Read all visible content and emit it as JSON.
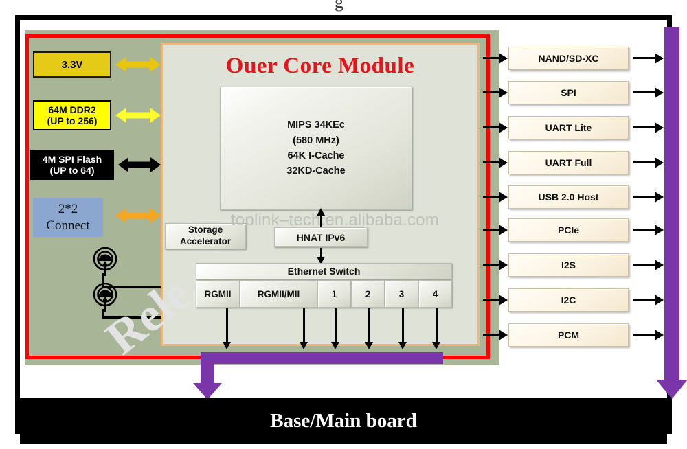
{
  "diagram": {
    "core_module": {
      "title": "Ouer Core Module",
      "cpu": {
        "line1": "MIPS 34KEc",
        "line2": "(580 MHz)",
        "line3": "64K I-Cache",
        "line4": "32KD-Cache"
      },
      "storage_accelerator": {
        "line1": "Storage",
        "line2": "Accelerator"
      },
      "hnat": "HNAT IPv6",
      "ethernet_switch": {
        "label": "Ethernet  Switch",
        "ports": [
          "RGMII",
          "RGMII/MII",
          "1",
          "2",
          "3",
          "4"
        ]
      }
    },
    "left_blocks": [
      {
        "name": "power",
        "line1": "3.3V",
        "line2": "",
        "color": "#e5cb18"
      },
      {
        "name": "ddr2",
        "line1": "64M DDR2",
        "line2": "(UP to 256)",
        "color": "#ffff00"
      },
      {
        "name": "spi-flash",
        "line1": "4M SPI Flash",
        "line2": "(UP to 64)",
        "color": "#000000"
      },
      {
        "name": "wifi-connect",
        "line1": "2*2",
        "line2": "Connect",
        "color": "#8ba7cf"
      }
    ],
    "left_arrow_colors": [
      "#e8c60e",
      "#ffff2e",
      "#000000",
      "#f5a623"
    ],
    "peripherals": [
      "NAND/SD-XC",
      "SPI",
      "UART Lite",
      "UART Full",
      "USB 2.0 Host",
      "PCIe",
      "I2S",
      "I2C",
      "PCM"
    ],
    "base_board": "Base/Main board",
    "colors": {
      "board_green": "#a8b596",
      "red_border": "#ff0000",
      "module_fill": "#dfe2d6",
      "module_border": "#eab77c",
      "title_red": "#e8121b",
      "bus_purple": "#7a35a8",
      "base_black": "#000000"
    },
    "watermarks": {
      "url": "toplink–tech.en.alibaba.com",
      "diagonal": "Rele"
    }
  }
}
